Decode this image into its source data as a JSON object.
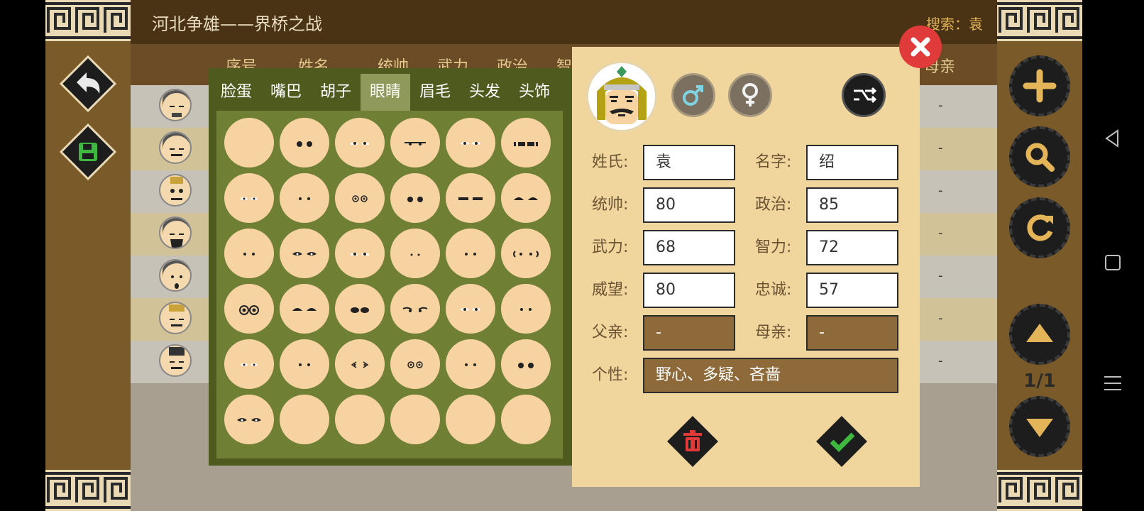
{
  "app": {
    "title": "河北争雄——界桥之战",
    "search_label": "搜索：袁"
  },
  "table_header": {
    "columns": [
      "序号",
      "姓名",
      "统帅",
      "武力",
      "政治",
      "智",
      "母亲"
    ]
  },
  "list_rows": [
    {
      "mother": "-"
    },
    {
      "mother": "-"
    },
    {
      "mother": "-"
    },
    {
      "mother": "-"
    },
    {
      "mother": "-"
    },
    {
      "mother": "-"
    },
    {
      "mother": "-"
    }
  ],
  "picker": {
    "tabs": [
      "脸蛋",
      "嘴巴",
      "胡子",
      "眼睛",
      "眉毛",
      "头发",
      "头饰"
    ],
    "active_tab": "眼睛"
  },
  "editor": {
    "surname_label": "姓氏:",
    "surname_value": "袁",
    "given_label": "名字:",
    "given_value": "绍",
    "command_label": "统帅:",
    "command_value": "80",
    "politics_label": "政治:",
    "politics_value": "85",
    "force_label": "武力:",
    "force_value": "68",
    "intellect_label": "智力:",
    "intellect_value": "72",
    "prestige_label": "威望:",
    "prestige_value": "80",
    "loyalty_label": "忠诚:",
    "loyalty_value": "57",
    "father_label": "父亲:",
    "father_value": "-",
    "mother_label": "母亲:",
    "mother_value": "-",
    "personality_label": "个性:",
    "personality_value": "野心、多疑、吝啬"
  },
  "pager": {
    "text": "1/1"
  },
  "icons": {
    "back": "back-arrow-icon",
    "save": "save-icon",
    "add": "plus-icon",
    "search": "search-icon",
    "refresh": "refresh-icon",
    "up": "triangle-up-icon",
    "down": "triangle-down-icon",
    "close": "close-icon",
    "delete": "trash-icon",
    "confirm": "checkmark-icon",
    "male": "male-icon",
    "female": "female-icon",
    "random": "shuffle-icon"
  },
  "colors": {
    "accent_red": "#e03a3a",
    "accent_green": "#3fb83f",
    "rail_brown": "#7a5a28",
    "dialog_bg": "#f0d59c"
  }
}
